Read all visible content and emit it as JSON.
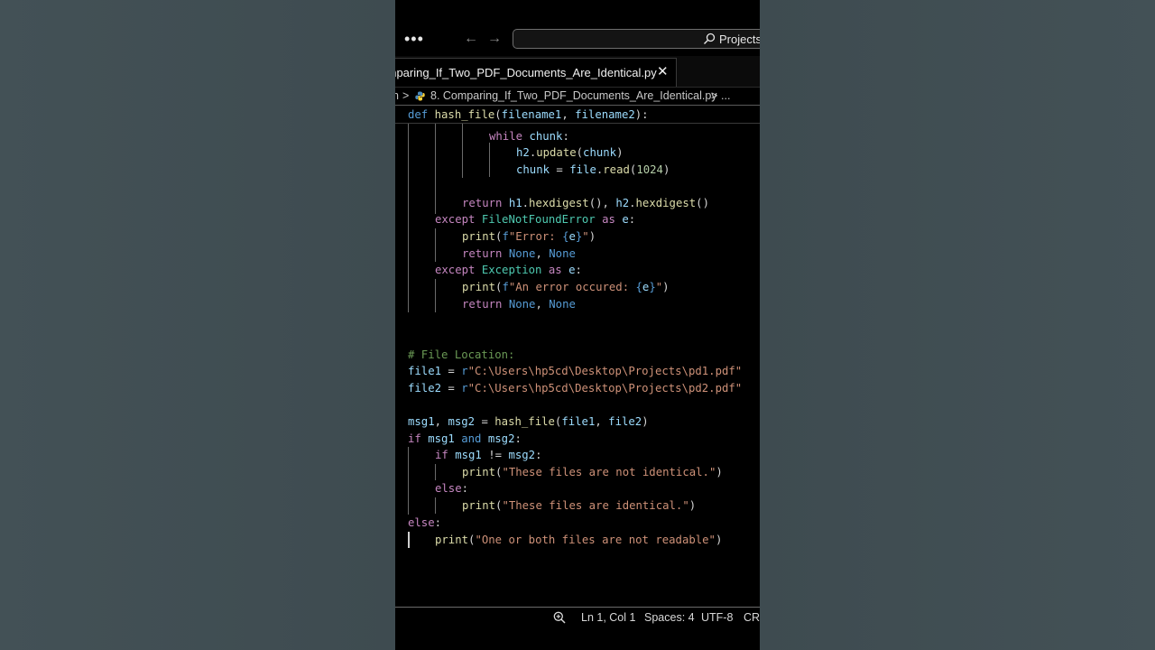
{
  "titlebar": {
    "more_icon": "more-icon",
    "search_label": "Projects"
  },
  "tab": {
    "label": "Comparing_If_Two_PDF_Documents_Are_Identical.py",
    "close": "✕"
  },
  "breadcrumb": {
    "folder_fragment": "n",
    "separator": ">",
    "file": "8. Comparing_If_Two_PDF_Documents_Are_Identical.py",
    "ellipsis": "..."
  },
  "editor": {
    "sticky_line": [
      "def",
      "hash_file",
      "(",
      "filename1",
      ", ",
      "filename2",
      "):"
    ],
    "lines": {
      "l1": [
        "while",
        "chunk",
        ":"
      ],
      "l2": [
        "h2",
        ".",
        "update",
        "(",
        "chunk",
        ")"
      ],
      "l3": [
        "chunk",
        " = ",
        "file",
        ".",
        "read",
        "(",
        "1024",
        ")"
      ],
      "l4": [
        "return",
        "h1",
        ".",
        "hexdigest",
        "(), ",
        "h2",
        ".",
        "hexdigest",
        "()"
      ],
      "l5": [
        "except",
        "FileNotFoundError",
        "as",
        "e",
        ":"
      ],
      "l6": [
        "print",
        "(",
        "f",
        "\"Error: ",
        "{",
        "e",
        "}",
        "\"",
        ")"
      ],
      "l7": [
        "return",
        "None",
        ", ",
        "None"
      ],
      "l8": [
        "except",
        "Exception",
        "as",
        "e",
        ":"
      ],
      "l9": [
        "print",
        "(",
        "f",
        "\"An error occured: ",
        "{",
        "e",
        "}",
        "\"",
        ")"
      ],
      "l10": [
        "return",
        "None",
        ", ",
        "None"
      ],
      "l11": [
        "# File Location:"
      ],
      "l12": [
        "file1",
        " = ",
        "r",
        "\"C:\\Users\\hp5cd\\Desktop\\Projects\\pd1.pdf\""
      ],
      "l13": [
        "file2",
        " = ",
        "r",
        "\"C:\\Users\\hp5cd\\Desktop\\Projects\\pd2.pdf\""
      ],
      "l14": [
        "msg1",
        ", ",
        "msg2",
        " = ",
        "hash_file",
        "(",
        "file1",
        ", ",
        "file2",
        ")"
      ],
      "l15": [
        "if",
        "msg1",
        "and",
        "msg2",
        ":"
      ],
      "l16": [
        "if",
        "msg1",
        " != ",
        "msg2",
        ":"
      ],
      "l17": [
        "print",
        "(",
        "\"These files are not identical.\"",
        ")"
      ],
      "l18": [
        "else",
        ":"
      ],
      "l19": [
        "print",
        "(",
        "\"These files are identical.\"",
        ")"
      ],
      "l20": [
        "else",
        ":"
      ],
      "l21": [
        "print",
        "(",
        "\"One or both files are not readable\"",
        ")"
      ]
    }
  },
  "statusbar": {
    "zoom_icon": "zoom-icon",
    "position": "Ln 1, Col 1",
    "spaces": "Spaces: 4",
    "encoding": "UTF-8",
    "eol": "CRL"
  },
  "colors": {
    "keyword": "#c586c0",
    "def_keyword": "#569cd6",
    "function": "#dcdcaa",
    "variable": "#9cdcfe",
    "class": "#4ec9b0",
    "string": "#ce9178",
    "number": "#b5cea8",
    "comment": "#6a9955"
  }
}
